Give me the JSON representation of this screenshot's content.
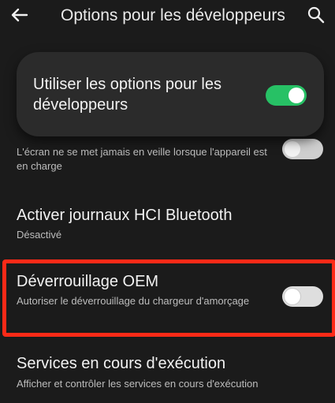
{
  "header": {
    "title": "Options pour les développeurs",
    "back_icon": "arrow-left-icon",
    "search_icon": "search-icon"
  },
  "master_switch": {
    "label": "Utiliser les options pour les développeurs",
    "state": "on"
  },
  "settings": {
    "stay_awake": {
      "subtitle": "L'écran ne se met jamais en veille lorsque l'appareil est en charge",
      "state": "off"
    },
    "bt_hci_log": {
      "title": "Activer journaux HCI Bluetooth",
      "subtitle": "Désactivé"
    },
    "oem_unlock": {
      "title": "Déverrouillage OEM",
      "subtitle": "Autoriser le déverrouillage du chargeur d'amorçage",
      "state": "off"
    },
    "running_services": {
      "title": "Services en cours d'exécution",
      "subtitle": "Afficher et contrôler les services en cours d'exécution"
    }
  },
  "colors": {
    "background": "#1b1b1b",
    "card": "#2b2b2b",
    "toggle_on": "#27c165",
    "highlight": "#ff2a17"
  }
}
